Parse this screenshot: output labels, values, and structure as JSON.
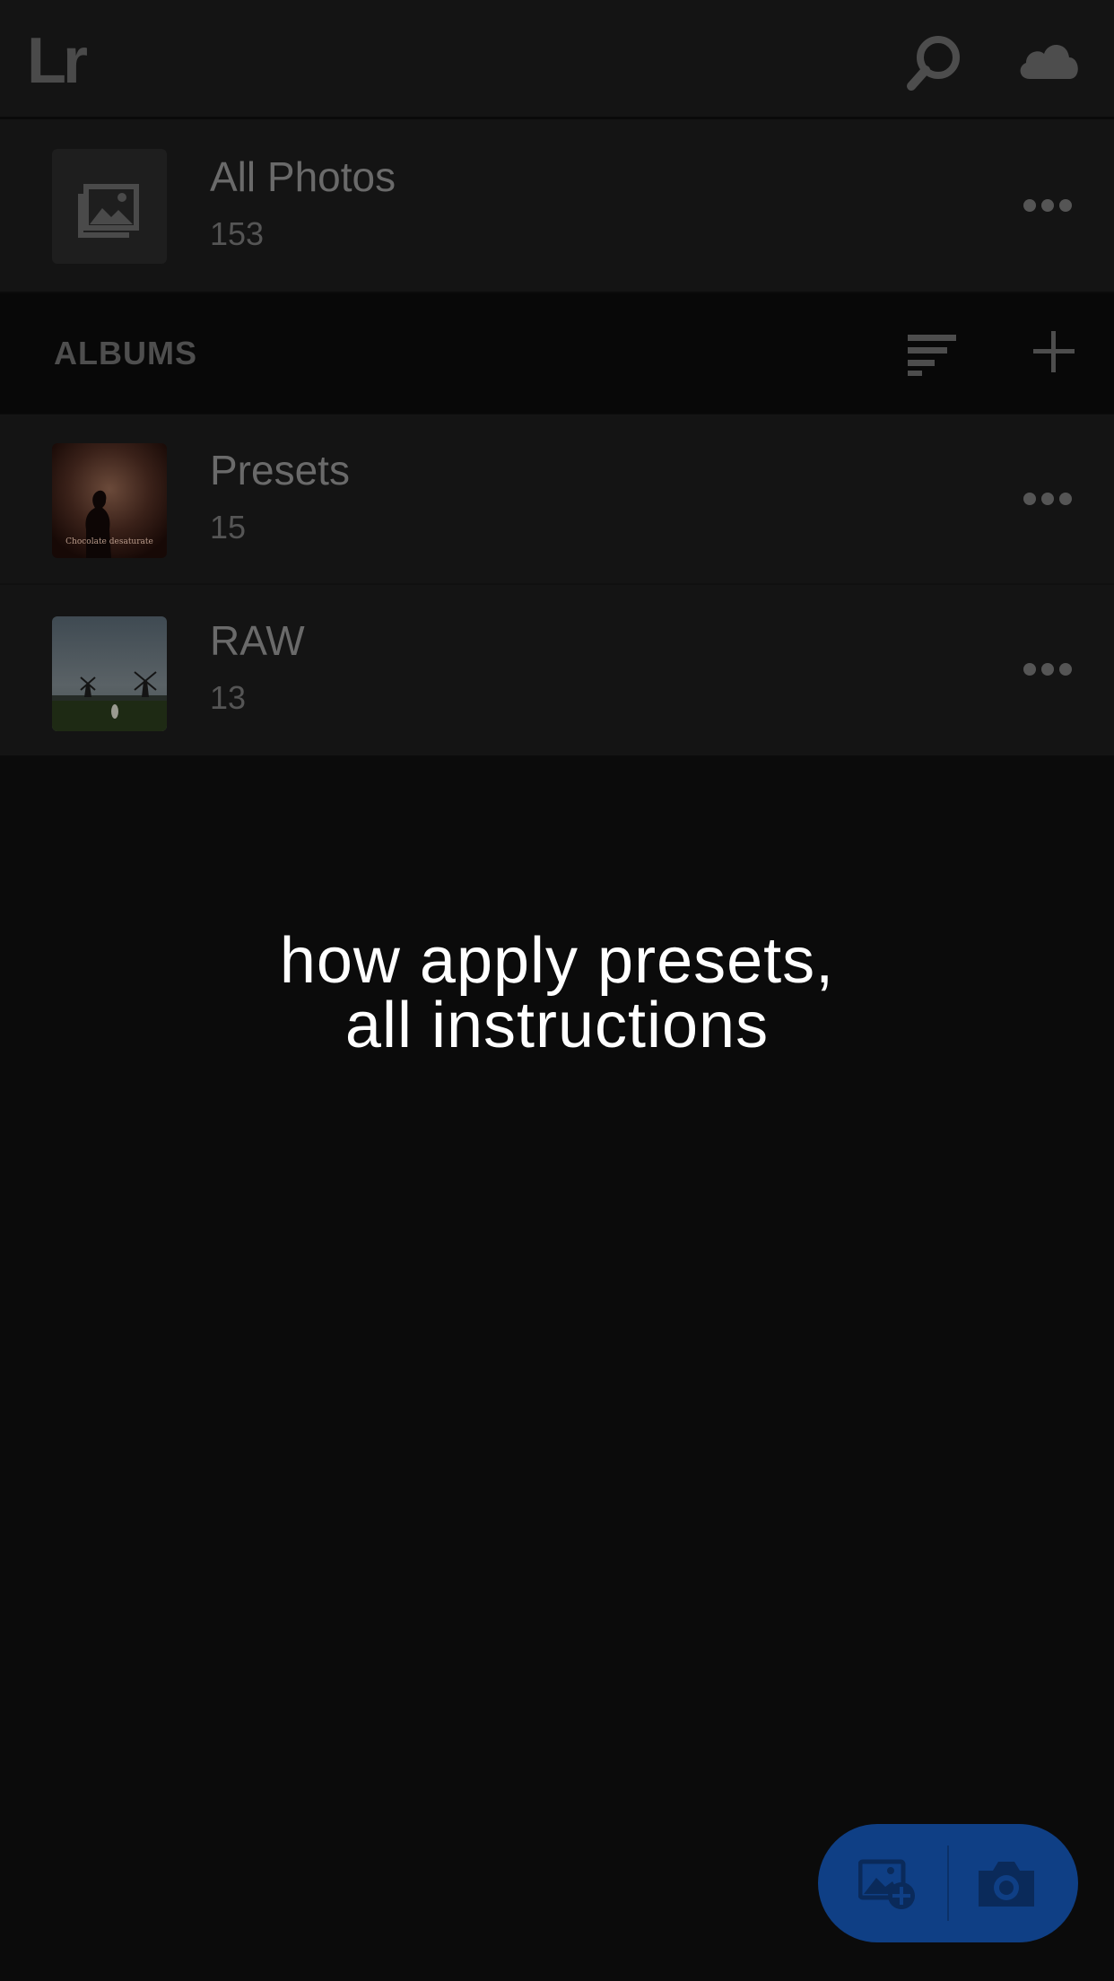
{
  "app": {
    "logo_text": "Lr"
  },
  "header": {
    "search_icon": "search-icon",
    "cloud_icon": "cloud-sync-icon"
  },
  "all_photos": {
    "title": "All Photos",
    "count": "153",
    "icon": "photos-stack-icon"
  },
  "albums": {
    "section_label": "ALBUMS",
    "sort_icon": "sort-icon",
    "add_icon": "plus-icon",
    "items": [
      {
        "title": "Presets",
        "count": "15",
        "thumb_caption": "Chocolate desaturate"
      },
      {
        "title": "RAW",
        "count": "13",
        "thumb_caption": ""
      }
    ]
  },
  "overlay": {
    "line1": "how apply presets,",
    "line2": "all instructions"
  },
  "fab": {
    "import_icon": "add-photo-icon",
    "camera_icon": "camera-icon",
    "color": "#0f3f85"
  }
}
